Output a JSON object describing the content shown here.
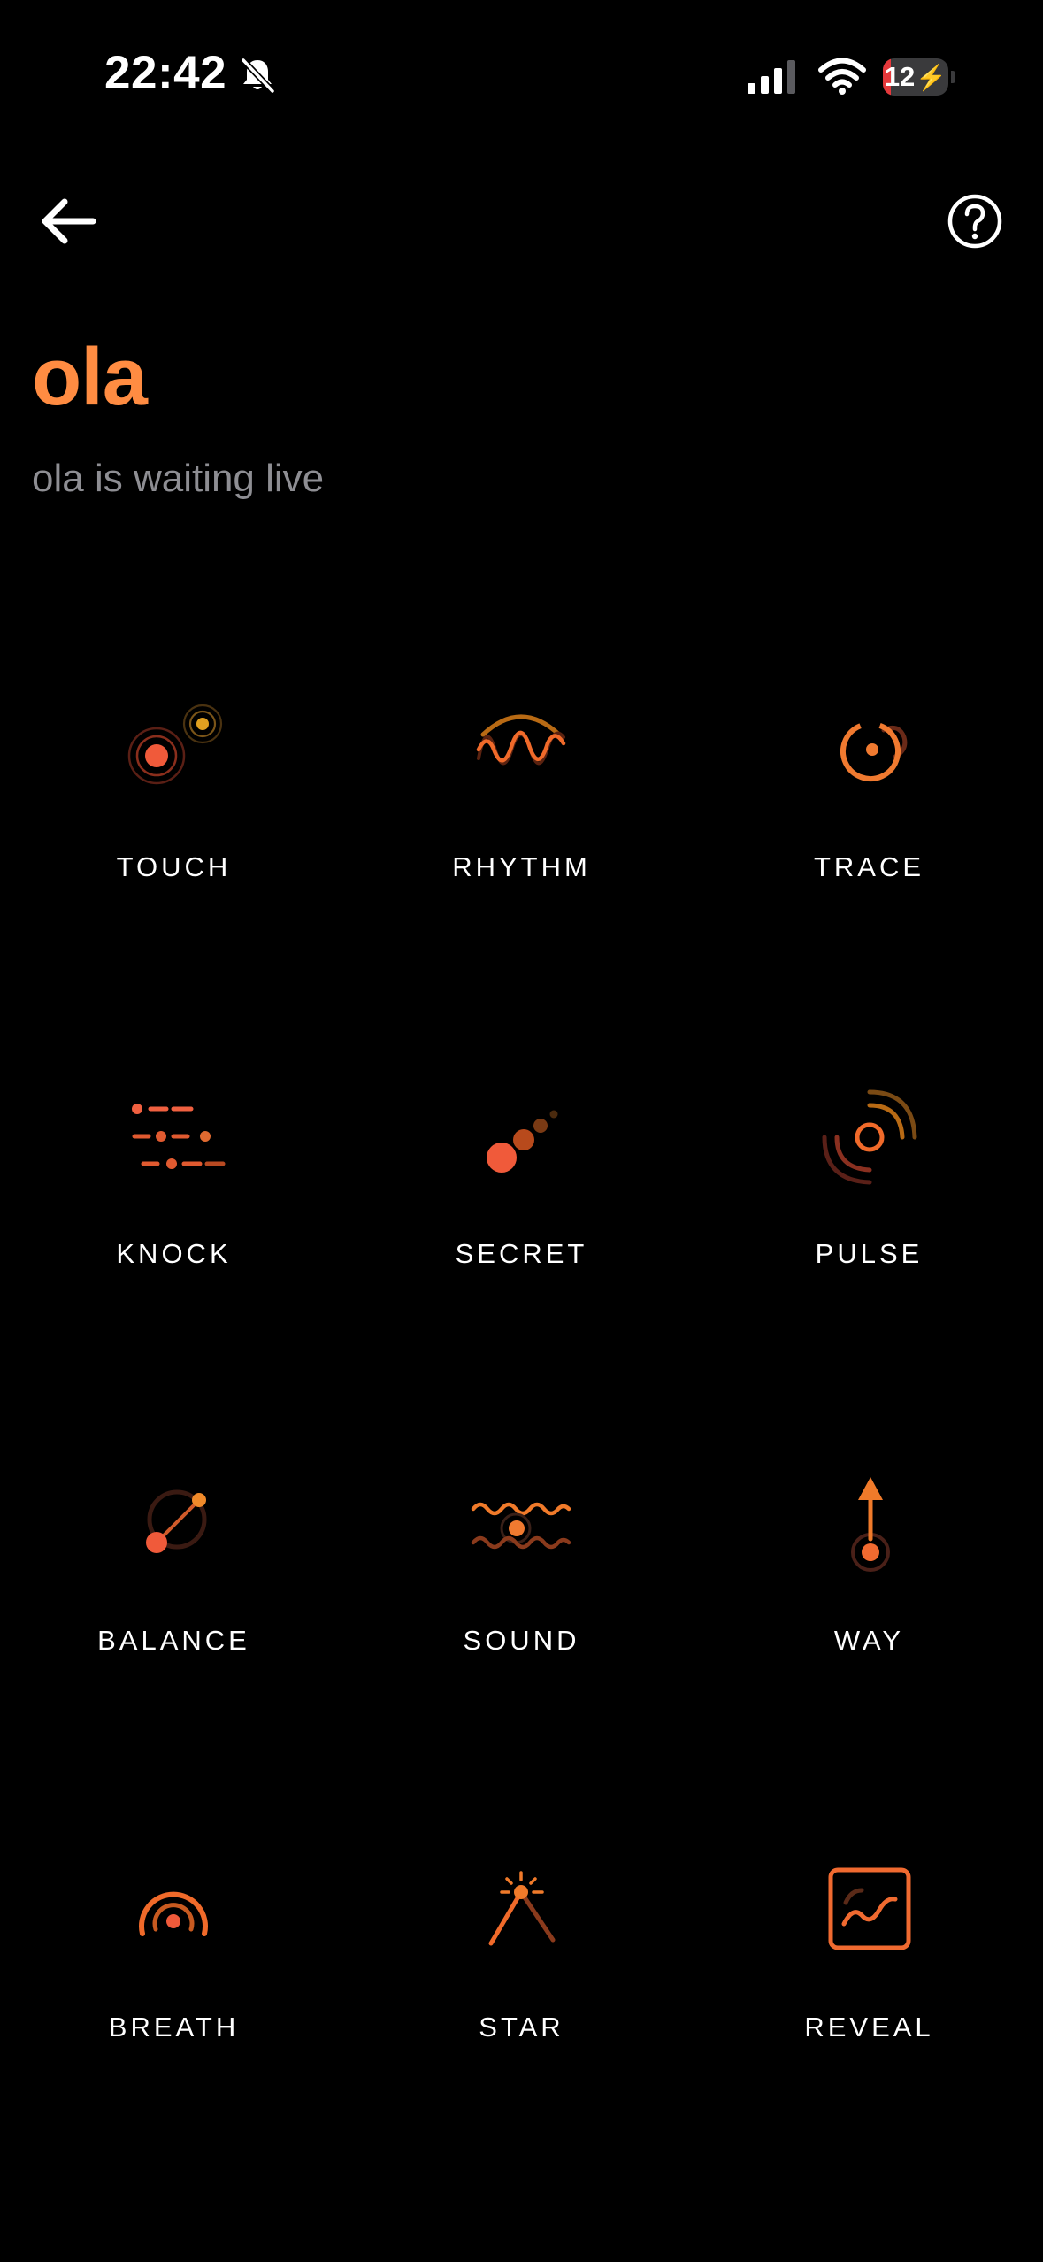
{
  "status_bar": {
    "time": "22:42",
    "battery_level": "12",
    "battery_fraction": 0.12,
    "icons": [
      "bell-slash-icon",
      "cellular-signal-icon",
      "wifi-icon",
      "battery-charging-icon"
    ]
  },
  "header": {
    "back_icon": "arrow-left-icon",
    "help_icon": "question-circle-icon"
  },
  "profile": {
    "name": "ola",
    "status": "ola is waiting live"
  },
  "colors": {
    "accent": "#ff8c42",
    "accent_red": "#f05a3a",
    "accent_amber": "#c98a1a",
    "background": "#000000",
    "muted_text": "#8e8e93"
  },
  "modes": [
    {
      "label": "TOUCH",
      "icon": "touch-icon"
    },
    {
      "label": "RHYTHM",
      "icon": "rhythm-icon"
    },
    {
      "label": "TRACE",
      "icon": "trace-icon"
    },
    {
      "label": "KNOCK",
      "icon": "knock-icon"
    },
    {
      "label": "SECRET",
      "icon": "secret-icon"
    },
    {
      "label": "PULSE",
      "icon": "pulse-icon"
    },
    {
      "label": "BALANCE",
      "icon": "balance-icon"
    },
    {
      "label": "SOUND",
      "icon": "sound-icon"
    },
    {
      "label": "WAY",
      "icon": "way-icon"
    },
    {
      "label": "BREATH",
      "icon": "breath-icon"
    },
    {
      "label": "STAR",
      "icon": "star-icon"
    },
    {
      "label": "REVEAL",
      "icon": "reveal-icon"
    }
  ]
}
